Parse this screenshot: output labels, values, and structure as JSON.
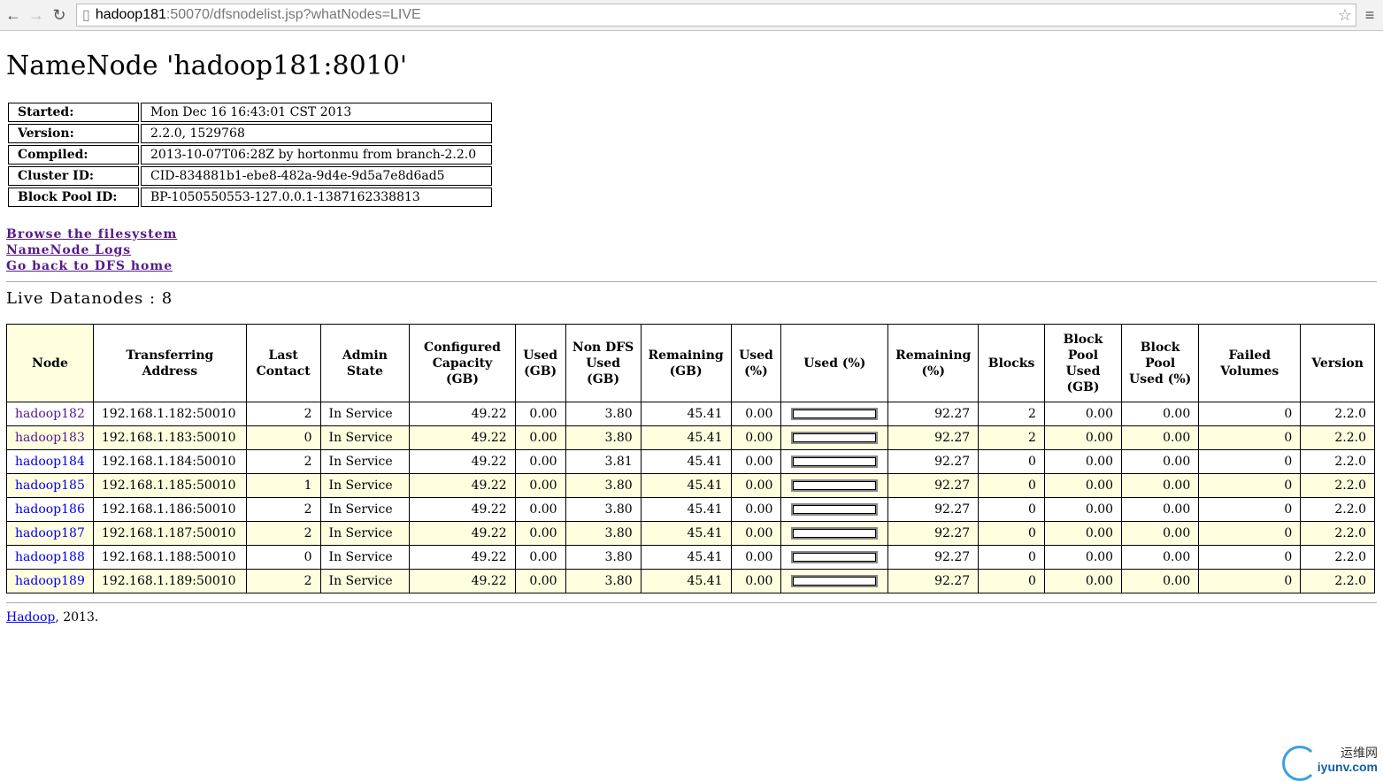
{
  "browser": {
    "url_host": "hadoop181",
    "url_rest": ":50070/dfsnodelist.jsp?whatNodes=LIVE"
  },
  "title": "NameNode 'hadoop181:8010'",
  "info": [
    {
      "label": "Started:",
      "value": "Mon Dec 16 16:43:01 CST 2013"
    },
    {
      "label": "Version:",
      "value": "2.2.0, 1529768"
    },
    {
      "label": "Compiled:",
      "value": "2013-10-07T06:28Z by hortonmu from branch-2.2.0"
    },
    {
      "label": "Cluster ID:",
      "value": "CID-834881b1-ebe8-482a-9d4e-9d5a7e8d6ad5"
    },
    {
      "label": "Block Pool ID:",
      "value": "BP-1050550553-127.0.0.1-1387162338813"
    }
  ],
  "links": [
    "Browse the filesystem",
    "NameNode Logs",
    "Go back to DFS home"
  ],
  "live_label": "Live Datanodes : 8",
  "columns": [
    "Node",
    "Transferring Address",
    "Last Contact",
    "Admin State",
    "Configured Capacity (GB)",
    "Used (GB)",
    "Non DFS Used (GB)",
    "Remaining (GB)",
    "Used (%)",
    "Used (%)",
    "Remaining (%)",
    "Blocks",
    "Block Pool Used (GB)",
    "Block Pool Used (%)",
    "Failed Volumes",
    "Version"
  ],
  "rows": [
    [
      "hadoop182",
      "192.168.1.182:50010",
      "2",
      "In Service",
      "49.22",
      "0.00",
      "3.80",
      "45.41",
      "0.00",
      "92.27",
      "2",
      "0.00",
      "0.00",
      "0",
      "2.2.0"
    ],
    [
      "hadoop183",
      "192.168.1.183:50010",
      "0",
      "In Service",
      "49.22",
      "0.00",
      "3.80",
      "45.41",
      "0.00",
      "92.27",
      "2",
      "0.00",
      "0.00",
      "0",
      "2.2.0"
    ],
    [
      "hadoop184",
      "192.168.1.184:50010",
      "2",
      "In Service",
      "49.22",
      "0.00",
      "3.81",
      "45.41",
      "0.00",
      "92.27",
      "0",
      "0.00",
      "0.00",
      "0",
      "2.2.0"
    ],
    [
      "hadoop185",
      "192.168.1.185:50010",
      "1",
      "In Service",
      "49.22",
      "0.00",
      "3.80",
      "45.41",
      "0.00",
      "92.27",
      "0",
      "0.00",
      "0.00",
      "0",
      "2.2.0"
    ],
    [
      "hadoop186",
      "192.168.1.186:50010",
      "2",
      "In Service",
      "49.22",
      "0.00",
      "3.80",
      "45.41",
      "0.00",
      "92.27",
      "0",
      "0.00",
      "0.00",
      "0",
      "2.2.0"
    ],
    [
      "hadoop187",
      "192.168.1.187:50010",
      "2",
      "In Service",
      "49.22",
      "0.00",
      "3.80",
      "45.41",
      "0.00",
      "92.27",
      "0",
      "0.00",
      "0.00",
      "0",
      "2.2.0"
    ],
    [
      "hadoop188",
      "192.168.1.188:50010",
      "0",
      "In Service",
      "49.22",
      "0.00",
      "3.80",
      "45.41",
      "0.00",
      "92.27",
      "0",
      "0.00",
      "0.00",
      "0",
      "2.2.0"
    ],
    [
      "hadoop189",
      "192.168.1.189:50010",
      "2",
      "In Service",
      "49.22",
      "0.00",
      "3.80",
      "45.41",
      "0.00",
      "92.27",
      "0",
      "0.00",
      "0.00",
      "0",
      "2.2.0"
    ]
  ],
  "visited_nodes": [
    "hadoop182",
    "hadoop183"
  ],
  "footer": {
    "link": "Hadoop",
    "text": ", 2013."
  },
  "watermark": {
    "cn": "运维网",
    "en": "iyunv.com"
  }
}
